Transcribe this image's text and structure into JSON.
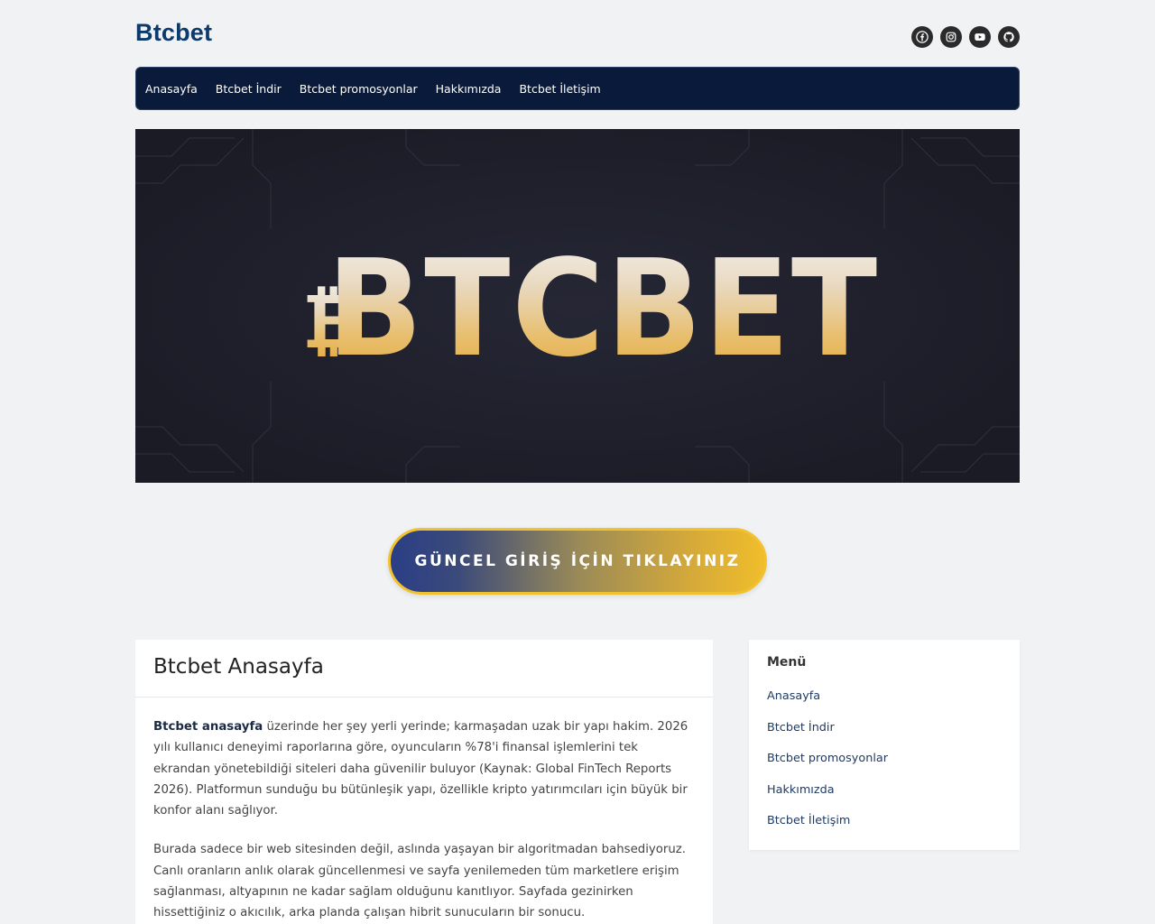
{
  "site": {
    "title": "Btcbet"
  },
  "social": [
    {
      "icon": "facebook-icon"
    },
    {
      "icon": "instagram-icon"
    },
    {
      "icon": "youtube-icon"
    },
    {
      "icon": "github-icon"
    }
  ],
  "nav": {
    "items": [
      {
        "label": "Anasayfa"
      },
      {
        "label": "Btcbet İndir"
      },
      {
        "label": "Btcbet promosyonlar"
      },
      {
        "label": "Hakkımızda"
      },
      {
        "label": "Btcbet İletişim"
      }
    ]
  },
  "hero": {
    "logo_text": "BTCBET",
    "logo_symbol": "₿"
  },
  "cta": {
    "label": "GÜNCEL GİRİŞ İÇİN TIKLAYINIZ"
  },
  "article": {
    "title": "Btcbet Anasayfa",
    "p1_bold": "Btcbet anasayfa",
    "p1_rest": " üzerinde her şey yerli yerinde; karmaşadan uzak bir yapı hakim. 2026 yılı kullanıcı deneyimi raporlarına göre, oyuncuların %78'i finansal işlemlerini tek ekrandan yönetebildiği siteleri daha güvenilir buluyor (Kaynak: Global FinTech Reports 2026). Platformun sunduğu bu bütünleşik yapı, özellikle kripto yatırımcıları için büyük bir konfor alanı sağlıyor.",
    "p2": "Burada sadece bir web sitesinden değil, aslında yaşayan bir algoritmadan bahsediyoruz. Canlı oranların anlık olarak güncellenmesi ve sayfa yenilemeden tüm marketlere erişim sağlanması, altyapının ne kadar sağlam olduğunu kanıtlıyor. Sayfada gezinirken hissettiğiniz o akıcılık, arka planda çalışan hibrit sunucuların bir sonucu."
  },
  "sidebar": {
    "title": "Menü",
    "items": [
      {
        "label": "Anasayfa"
      },
      {
        "label": "Btcbet İndir"
      },
      {
        "label": "Btcbet promosyonlar"
      },
      {
        "label": "Hakkımızda"
      },
      {
        "label": "Btcbet İletişim"
      }
    ]
  },
  "colors": {
    "page_bg": "#f1f2f4",
    "nav_bg": "#0a1a3a",
    "title_blue": "#0b3a6b",
    "hero_bg": "#1e1f2b",
    "gold": "#f2c12e"
  }
}
